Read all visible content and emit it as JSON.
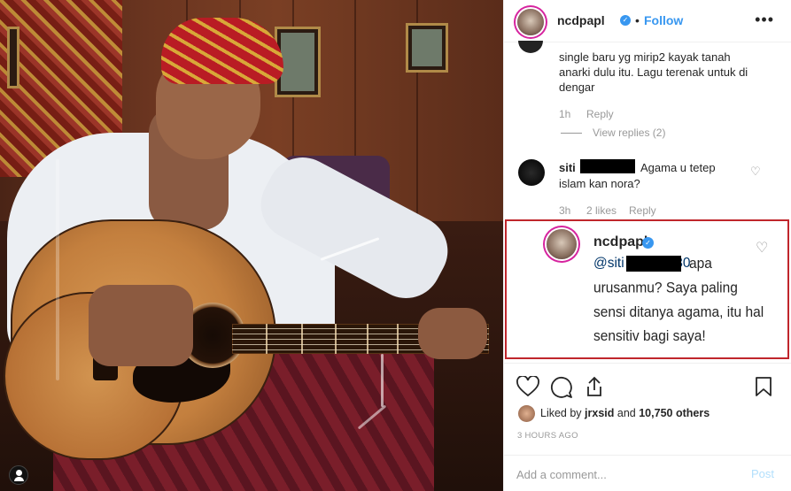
{
  "post": {
    "username": "ncdpapl",
    "follow_label": "Follow",
    "separator": "•",
    "more_label": "•••"
  },
  "comments": [
    {
      "text": "single baru yg mirip2 kayak tanah anarki dulu itu. Lagu terenak untuk di dengar",
      "time": "1h",
      "reply_label": "Reply",
      "view_replies": "View replies (2)"
    },
    {
      "username": "siti",
      "text_line1": "Agama u tetep",
      "text_line2": "islam kan nora?",
      "time": "3h",
      "likes": "2 likes",
      "reply_label": "Reply"
    }
  ],
  "highlighted_reply": {
    "username": "ncdpapl",
    "mention": "@siti",
    "mention_tail": "3130",
    "text": "apa urusanmu? Saya paling sensi ditanya agama, itu hal sensitiv bagi saya!"
  },
  "likes": {
    "prefix": "Liked by",
    "user": "jrxsid",
    "connector": "and",
    "count": "10,750 others"
  },
  "time_ago": "3 HOURS AGO",
  "add_comment": {
    "placeholder": "Add a comment...",
    "post_label": "Post"
  },
  "colors": {
    "follow_blue": "#3897f0",
    "post_disabled": "#b2dffc",
    "highlight_border": "#c0262c"
  },
  "icons": [
    "more-icon",
    "heart-icon",
    "comment-icon",
    "share-icon",
    "bookmark-icon",
    "verified-icon",
    "user-tag-icon"
  ]
}
